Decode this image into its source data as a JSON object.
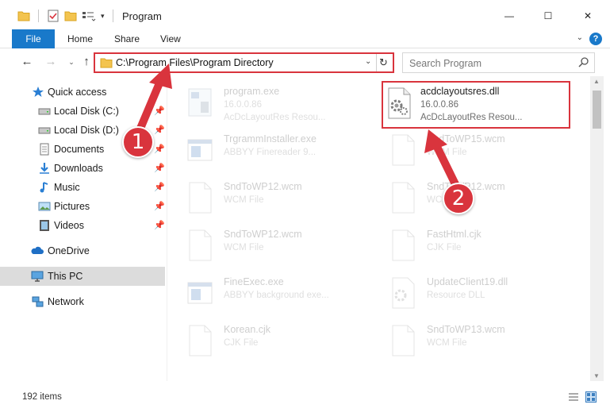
{
  "window": {
    "title": "Program",
    "controls": {
      "minimize": "—",
      "maximize": "☐",
      "close": "✕"
    }
  },
  "ribbon": {
    "tabs": [
      "File",
      "Home",
      "Share",
      "View"
    ],
    "help": "?"
  },
  "nav": {
    "address": "C:\\Program Files\\Program Directory",
    "search_placeholder": "Search Program"
  },
  "sidebar": {
    "items": [
      {
        "label": "Quick access",
        "icon": "star-icon",
        "pinned": false
      },
      {
        "label": "Local Disk (C:)",
        "icon": "drive-icon",
        "pinned": true
      },
      {
        "label": "Local Disk (D:)",
        "icon": "drive-icon",
        "pinned": true
      },
      {
        "label": "Documents",
        "icon": "documents-icon",
        "pinned": true
      },
      {
        "label": "Downloads",
        "icon": "download-icon",
        "pinned": true
      },
      {
        "label": "Music",
        "icon": "music-icon",
        "pinned": true
      },
      {
        "label": "Pictures",
        "icon": "pictures-icon",
        "pinned": true
      },
      {
        "label": "Videos",
        "icon": "videos-icon",
        "pinned": true
      },
      {
        "label": "OneDrive",
        "icon": "cloud-icon",
        "pinned": false
      },
      {
        "label": "This PC",
        "icon": "computer-icon",
        "pinned": false,
        "selected": true
      },
      {
        "label": "Network",
        "icon": "network-icon",
        "pinned": false
      }
    ]
  },
  "files": [
    {
      "name": "program.exe",
      "line1": "16.0.0.86",
      "line2": "AcDcLayoutRes Resou...",
      "icon": "exe-icon"
    },
    {
      "name": "acdclayoutsres.dll",
      "line1": "16.0.0.86",
      "line2": "AcDcLayoutRes Resou...",
      "icon": "dll-gear-icon",
      "highlighted": true
    },
    {
      "name": "TrgrammInstaller.exe",
      "line1": "ABBYY Finereader 9...",
      "line2": "",
      "icon": "app-window-icon"
    },
    {
      "name": "SndToWP15.wcm",
      "line1": "WCM File",
      "line2": "",
      "icon": "blank-file-icon"
    },
    {
      "name": "SndToWP12.wcm",
      "line1": "WCM File",
      "line2": "",
      "icon": "blank-file-icon"
    },
    {
      "name": "SndToWP12.wcm",
      "line1": "WCM File",
      "line2": "",
      "icon": "blank-file-icon"
    },
    {
      "name": "SndToWP12.wcm",
      "line1": "WCM File",
      "line2": "",
      "icon": "blank-file-icon"
    },
    {
      "name": "FastHtml.cjk",
      "line1": "CJK File",
      "line2": "",
      "icon": "blank-file-icon"
    },
    {
      "name": "FineExec.exe",
      "line1": "ABBYY background exe...",
      "line2": "",
      "icon": "app-window-icon"
    },
    {
      "name": "UpdateClient19.dll",
      "line1": "Resource DLL",
      "line2": "",
      "icon": "dll-gear-icon"
    },
    {
      "name": "Korean.cjk",
      "line1": "CJK File",
      "line2": "",
      "icon": "blank-file-icon"
    },
    {
      "name": "SndToWP13.wcm",
      "line1": "WCM File",
      "line2": "",
      "icon": "blank-file-icon"
    }
  ],
  "status": {
    "item_count": "192 items"
  },
  "callouts": [
    "1",
    "2"
  ],
  "colors": {
    "accent": "#1979ca",
    "highlight": "#d9343d"
  }
}
